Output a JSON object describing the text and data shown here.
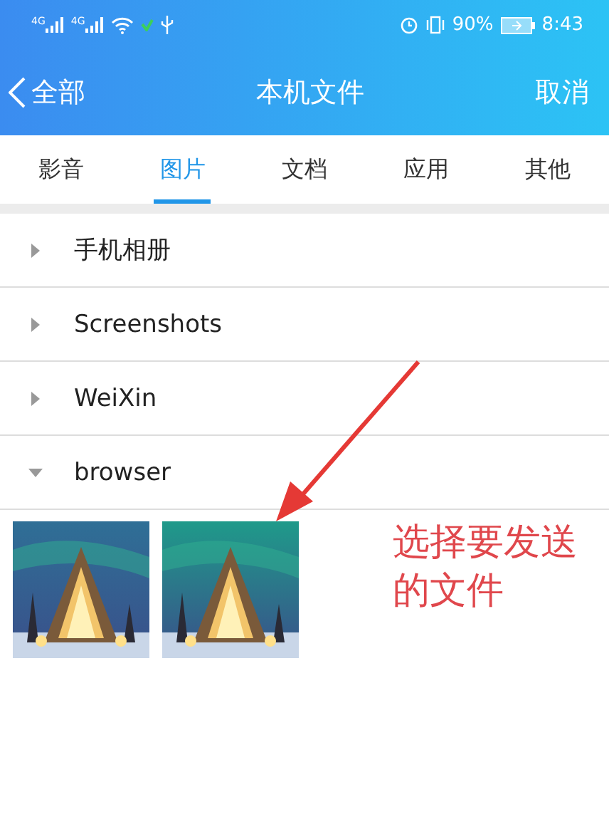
{
  "status_bar": {
    "signals": [
      "4G",
      "4G"
    ],
    "battery": "90%",
    "time": "8:43"
  },
  "nav": {
    "back": "全部",
    "title": "本机文件",
    "action": "取消"
  },
  "tabs": [
    {
      "label": "影音",
      "selected": false
    },
    {
      "label": "图片",
      "selected": true
    },
    {
      "label": "文档",
      "selected": false
    },
    {
      "label": "应用",
      "selected": false
    },
    {
      "label": "其他",
      "selected": false
    }
  ],
  "folders": [
    {
      "name": "手机相册",
      "expanded": false
    },
    {
      "name": "Screenshots",
      "expanded": false
    },
    {
      "name": "WeiXin",
      "expanded": false
    },
    {
      "name": "browser",
      "expanded": true
    }
  ],
  "annotation": {
    "lines": [
      "选择要发送",
      "的文件"
    ]
  }
}
